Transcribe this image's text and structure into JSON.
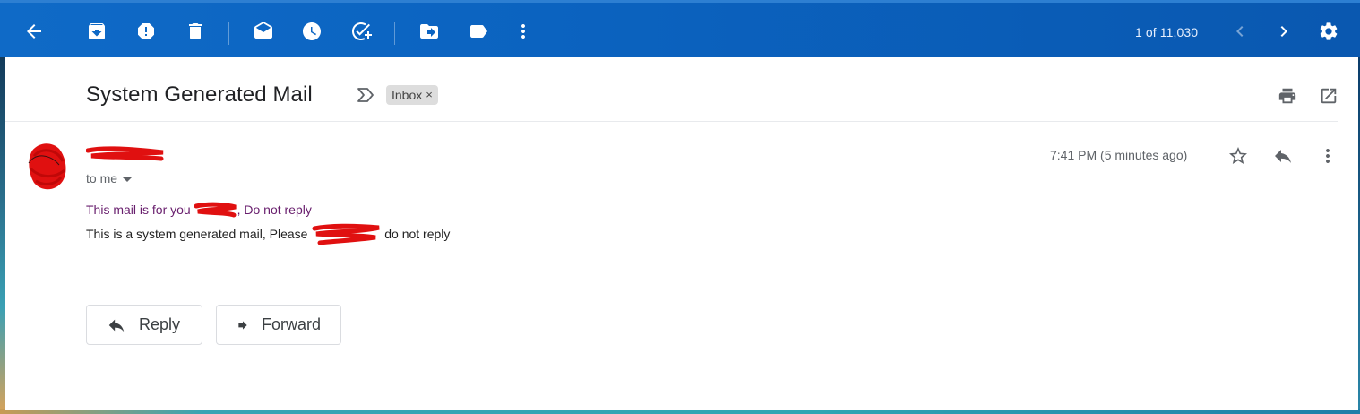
{
  "toolbar": {
    "message_count": "1 of 11,030",
    "icons": [
      "back-arrow-icon",
      "archive-icon",
      "report-spam-icon",
      "delete-icon",
      "mark-unread-icon",
      "snooze-icon",
      "add-to-tasks-icon",
      "move-to-icon",
      "label-icon",
      "more-vert-icon",
      "chevron-left-icon",
      "chevron-right-icon",
      "settings-gear-icon"
    ]
  },
  "message": {
    "subject": "System Generated Mail",
    "label": "Inbox",
    "label_close": "×",
    "recipient": "to me",
    "timestamp": "7:41 PM (5 minutes ago)",
    "body_line1_pre": "This mail is for you ",
    "body_line1_post": ", Do not reply",
    "body_line2_pre": "This is a system generated mail, Please ",
    "body_line2_post": " do not reply"
  },
  "actions": {
    "reply_label": "Reply",
    "forward_label": "Forward"
  },
  "colors": {
    "toolbar_bg": "#0b63c0",
    "redaction": "#e01010",
    "link_purple": "#681e6d"
  }
}
